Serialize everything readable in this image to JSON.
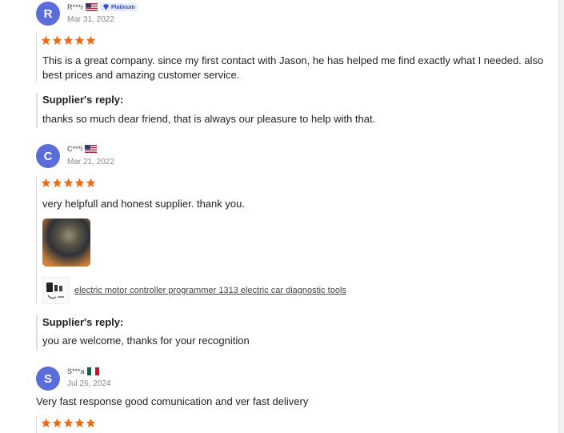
{
  "reviews": [
    {
      "initial": "R",
      "name": "R***r",
      "country": "US",
      "badge": "Platinum",
      "date": "Mar 31, 2022",
      "rating": 5,
      "text": "This is a great company. since my first contact with Jason, he has helped me find exactly what I needed. also best prices and amazing customer service.",
      "reply_label": "Supplier's reply:",
      "reply": "thanks so much dear friend, that is always our pleasure to help with that."
    },
    {
      "initial": "C",
      "name": "C***l",
      "country": "US",
      "date": "Mar 21, 2022",
      "rating": 5,
      "text": "very helpfull and honest supplier. thank you.",
      "product_link": "electric motor controller programmer 1313 electric car diagnostic tools",
      "reply_label": "Supplier's reply:",
      "reply": "you are welcome, thanks for your recognition"
    },
    {
      "initial": "S",
      "name": "S***a",
      "country": "MX",
      "date": "Jul 26, 2024",
      "rating": 5,
      "text": "Very fast response good comunication and ver fast delivery"
    }
  ],
  "colors": {
    "avatar": "#5b6dd8",
    "star": "#f26a10",
    "badge_bg": "#e6ecff"
  },
  "icons": {
    "star": "star-icon",
    "platinum": "diamond-icon"
  }
}
